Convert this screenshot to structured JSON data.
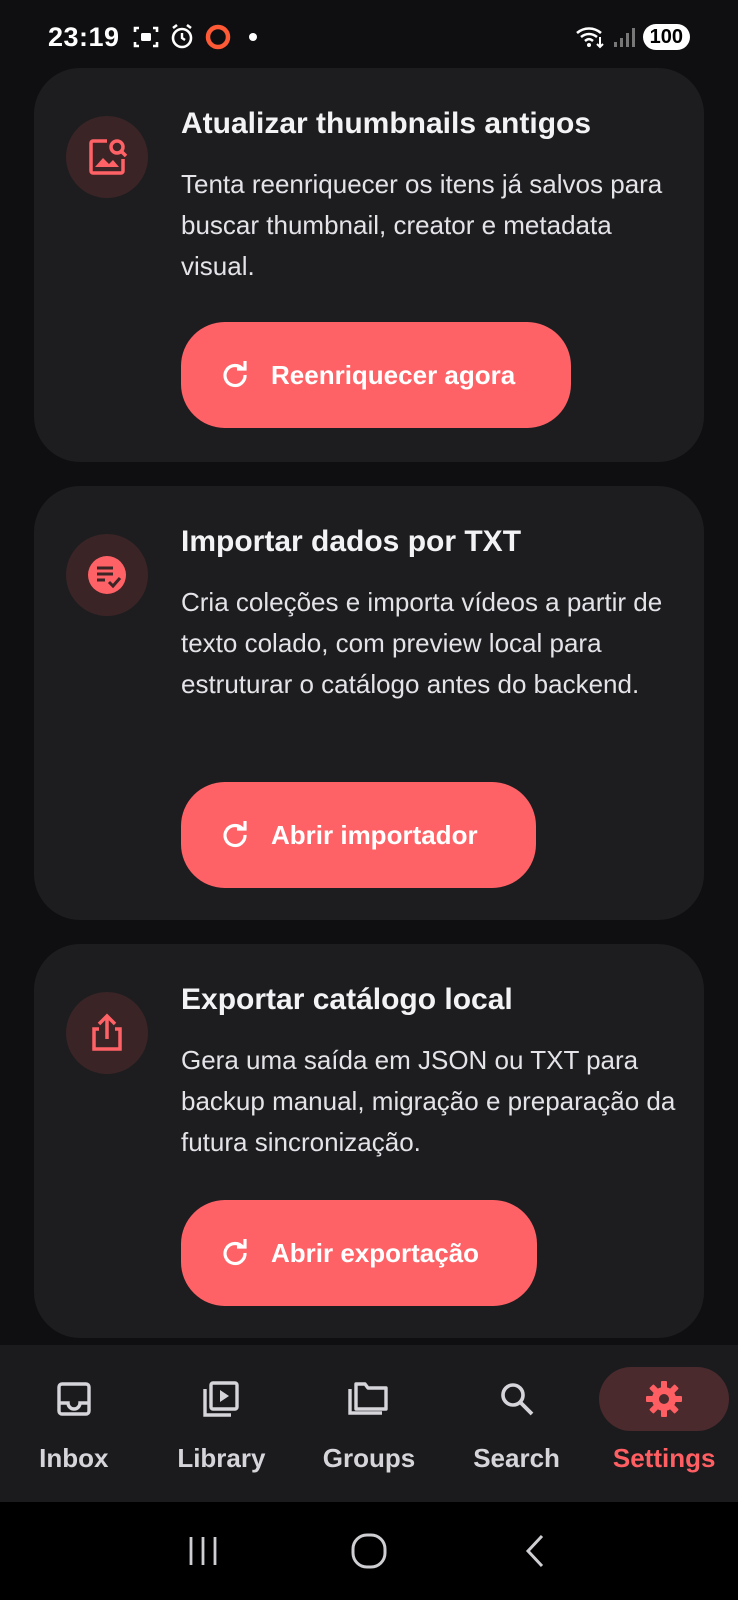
{
  "status_bar": {
    "time": "23:19",
    "battery": "100",
    "icons": [
      "screenshot-icon",
      "alarm-icon",
      "record-ring-icon",
      "notification-dot",
      "wifi-icon",
      "signal-icon"
    ]
  },
  "cards": [
    {
      "icon": "image-search-icon",
      "title": "Atualizar thumbnails antigos",
      "description": "Tenta reenriquecer os itens já salvos para buscar thumbnail, creator e metadata visual.",
      "button_label": "Reenriquecer agora",
      "button_icon": "refresh-icon"
    },
    {
      "icon": "list-check-icon",
      "title": "Importar dados por TXT",
      "description": "Cria coleções e importa vídeos a partir de texto colado, com preview local para estruturar o catálogo antes do backend.",
      "button_label": "Abrir importador",
      "button_icon": "refresh-icon"
    },
    {
      "icon": "share-icon",
      "title": "Exportar catálogo local",
      "description": "Gera uma saída em JSON ou TXT para backup manual, migração e preparação da futura sincronização.",
      "button_label": "Abrir exportação",
      "button_icon": "refresh-icon"
    }
  ],
  "bottom_nav": {
    "items": [
      {
        "label": "Inbox",
        "icon": "inbox-icon",
        "active": false
      },
      {
        "label": "Library",
        "icon": "video-library-icon",
        "active": false
      },
      {
        "label": "Groups",
        "icon": "folders-icon",
        "active": false
      },
      {
        "label": "Search",
        "icon": "search-icon",
        "active": false
      },
      {
        "label": "Settings",
        "icon": "gear-icon",
        "active": true
      }
    ]
  },
  "colors": {
    "accent": "#ff6266",
    "card_bg": "#1d1d20",
    "page_bg": "#0f0f11",
    "icon_circle_bg": "#3a2426"
  }
}
